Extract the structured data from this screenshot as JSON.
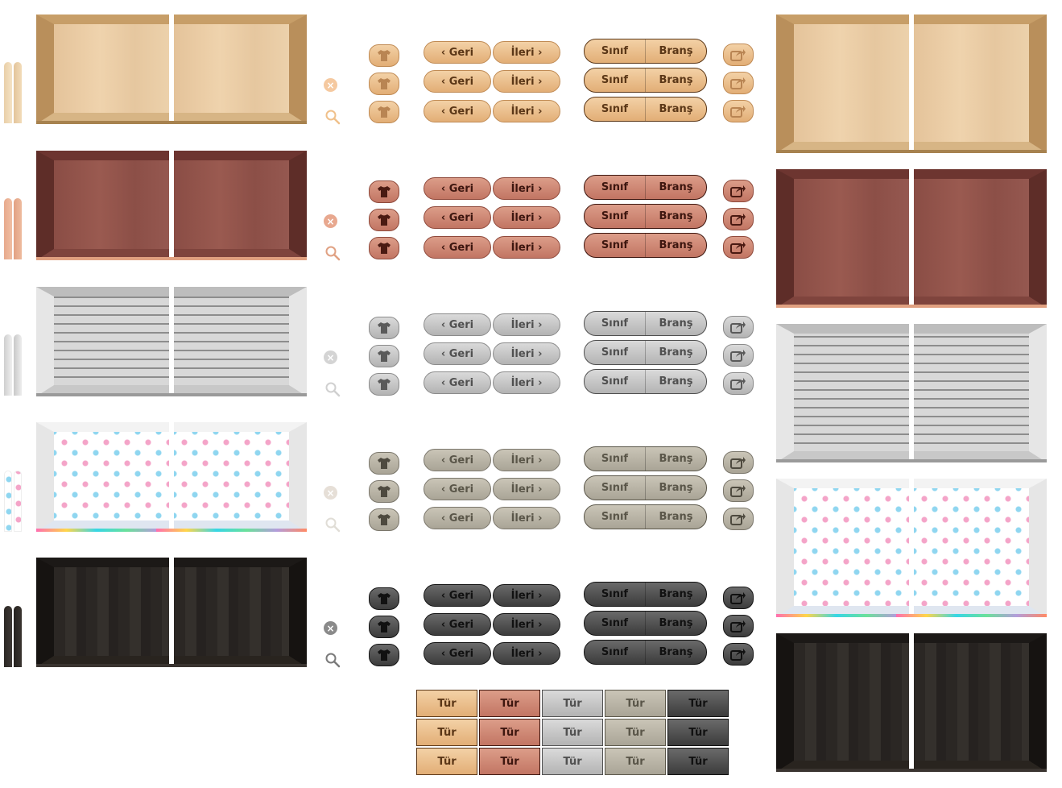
{
  "rows": [
    {
      "theme": "wood-light",
      "buttons": {
        "back": "Geri",
        "forward": "İleri",
        "class": "Sınıf",
        "branch": "Branş"
      },
      "clear_icon_color": "#f5c9a0",
      "search_icon_color": "#f0c08a"
    },
    {
      "theme": "wood-red",
      "buttons": {
        "back": "Geri",
        "forward": "İleri",
        "class": "Sınıf",
        "branch": "Branş"
      },
      "clear_icon_color": "#e8a88f",
      "search_icon_color": "#e0a183"
    },
    {
      "theme": "brick",
      "buttons": {
        "back": "Geri",
        "forward": "İleri",
        "class": "Sınıf",
        "branch": "Branş"
      },
      "clear_icon_color": "#d4d4d4",
      "search_icon_color": "#d0d0d0"
    },
    {
      "theme": "dots",
      "buttons": {
        "back": "Geri",
        "forward": "İleri",
        "class": "Sınıf",
        "branch": "Branş"
      },
      "clear_icon_color": "#e6dfd7",
      "search_icon_color": "#e0ddd6"
    },
    {
      "theme": "dark",
      "buttons": {
        "back": "Geri",
        "forward": "İleri",
        "class": "Sınıf",
        "branch": "Branş"
      },
      "clear_icon_color": "#8a8a8a",
      "search_icon_color": "#7a7a7a"
    }
  ],
  "tiles": {
    "label": "Tür",
    "themes": [
      "wood-light",
      "wood-red",
      "grey",
      "taupe",
      "dark"
    ]
  },
  "icons": {
    "shirt": "t-shirt-icon",
    "share": "share-icon",
    "clear": "clear-x-icon",
    "search": "search-icon",
    "back": "chevron-left-icon",
    "forward": "chevron-right-icon"
  },
  "colors": {
    "wood_light": "#e6c195",
    "wood_red": "#935348",
    "brick": "#d2d2d2",
    "dots_bg": "#ffffff",
    "dark_wood": "#2e2a27"
  }
}
